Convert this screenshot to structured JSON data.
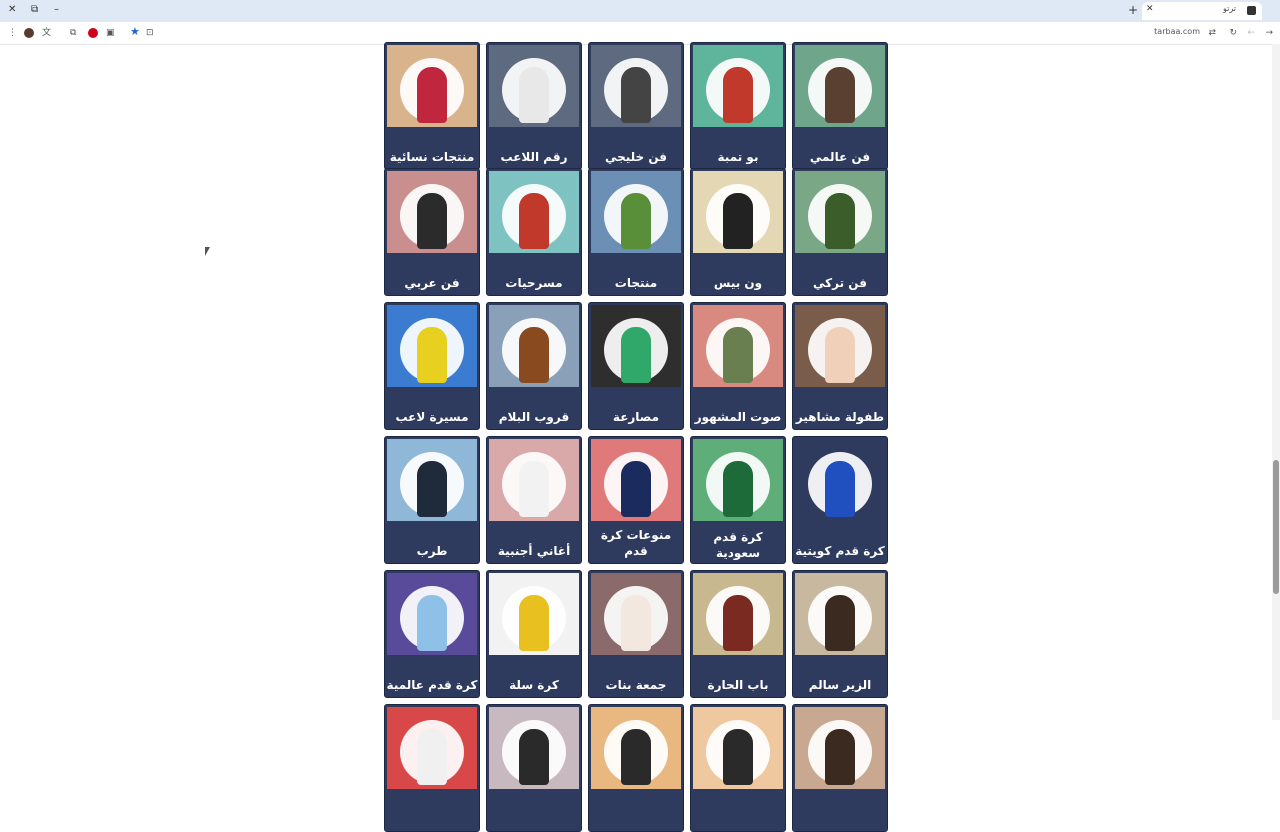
{
  "browser": {
    "tab_title": "ترتو",
    "domain": "tarbaa.com"
  },
  "rows": [
    [
      {
        "label": "فن عالمي",
        "bg": "#6fa58a",
        "fig": "#5a4030"
      },
      {
        "label": "بو تمبة",
        "bg": "#5fb59b",
        "fig": "#c0392b"
      },
      {
        "label": "فن خليجي",
        "bg": "#5d6a80",
        "fig": "#444444"
      },
      {
        "label": "رقم اللاعب",
        "bg": "#5d6a80",
        "fig": "#e8e8e8"
      },
      {
        "label": "منتجات نسائية",
        "bg": "#d9b38c",
        "fig": "#c0263e"
      }
    ],
    [
      {
        "label": "فن تركي",
        "bg": "#7aa886",
        "fig": "#3b5d2a"
      },
      {
        "label": "ون بيس",
        "bg": "#e4d7b4",
        "fig": "#222222"
      },
      {
        "label": "منتجات",
        "bg": "#6b8fb5",
        "fig": "#5a8f3a"
      },
      {
        "label": "مسرحيات",
        "bg": "#7fc2c2",
        "fig": "#c0392b"
      },
      {
        "label": "فن عربي",
        "bg": "#c98f8f",
        "fig": "#2b2b2b"
      }
    ],
    [
      {
        "label": "طفولة مشاهير",
        "bg": "#7a5c4a",
        "fig": "#f0d0b8"
      },
      {
        "label": "صوت المشهور",
        "bg": "#d98a80",
        "fig": "#6a7f50"
      },
      {
        "label": "مصارعة",
        "bg": "#2e2e2e",
        "fig": "#2fa86a"
      },
      {
        "label": "قروب البلام",
        "bg": "#8aa0b8",
        "fig": "#8a4a20"
      },
      {
        "label": "مسيرة لاعب",
        "bg": "#3b7bd0",
        "fig": "#e8d020"
      }
    ],
    [
      {
        "label": "كرة قدم كويتية",
        "bg": "#2f3b5e",
        "fig": "#2050c0"
      },
      {
        "label": "كرة قدم سعودية",
        "bg": "#5fae7a",
        "fig": "#1e6b3a"
      },
      {
        "label": "منوعات كرة قدم",
        "bg": "#e07a7a",
        "fig": "#1b2b5e"
      },
      {
        "label": "أغاني أجنبية",
        "bg": "#d9a8a8",
        "fig": "#f2f2f2"
      },
      {
        "label": "طرب",
        "bg": "#8fb8d8",
        "fig": "#1f2a3a"
      }
    ],
    [
      {
        "label": "الزير سالم",
        "bg": "#c8b8a0",
        "fig": "#3a2a20"
      },
      {
        "label": "باب الحارة",
        "bg": "#c8b890",
        "fig": "#7a2a20"
      },
      {
        "label": "جمعة بنات",
        "bg": "#8a6a6a",
        "fig": "#f2e8e0"
      },
      {
        "label": "كرة سلة",
        "bg": "#f2f2f2",
        "fig": "#e8c020"
      },
      {
        "label": "كرة قدم عالمية",
        "bg": "#5a4a9a",
        "fig": "#8fc0e8"
      }
    ],
    [
      {
        "label": "",
        "bg": "#c8a890",
        "fig": "#3a2a20"
      },
      {
        "label": "",
        "bg": "#f0c8a0",
        "fig": "#2a2a2a"
      },
      {
        "label": "",
        "bg": "#e8b880",
        "fig": "#2a2a2a"
      },
      {
        "label": "",
        "bg": "#c8b8c0",
        "fig": "#2a2a2a"
      },
      {
        "label": "",
        "bg": "#d84848",
        "fig": "#f0f0f0"
      }
    ]
  ]
}
